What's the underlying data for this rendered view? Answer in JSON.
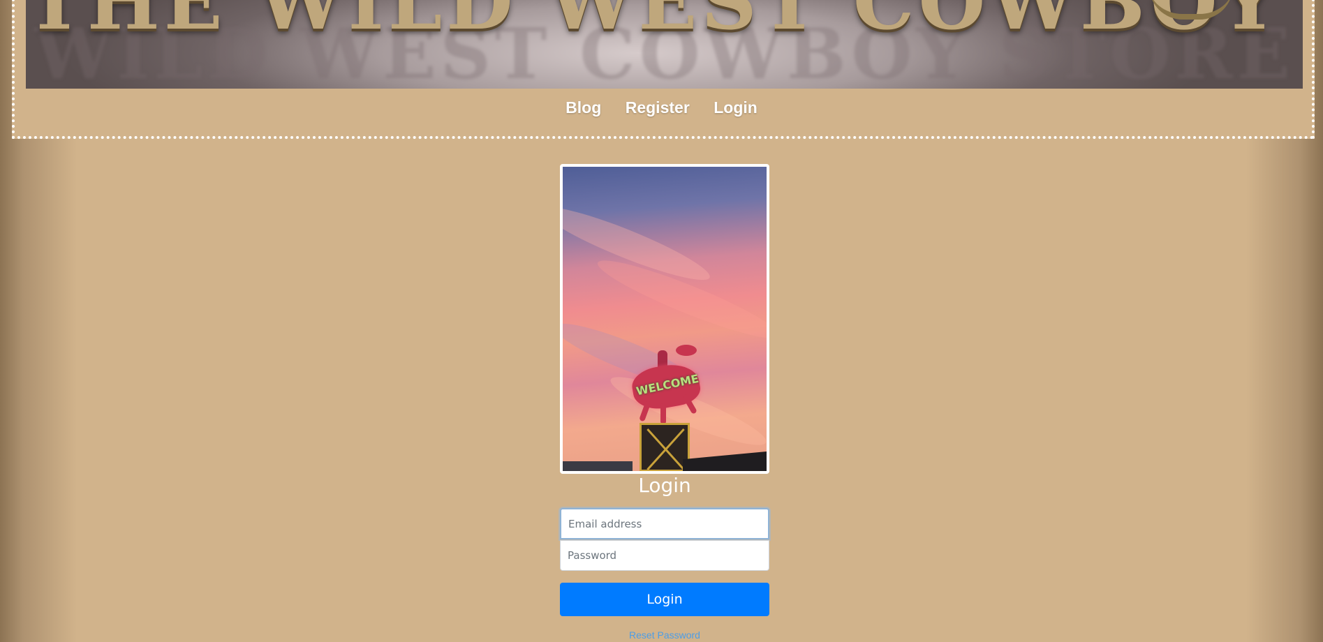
{
  "header": {
    "banner_title": "THE WILD WEST COWBOY STORE",
    "banner_shadow_text": "WILD WEST COWBOY STORE"
  },
  "nav": {
    "items": [
      {
        "label": "Blog"
      },
      {
        "label": "Register"
      },
      {
        "label": "Login"
      }
    ]
  },
  "hero": {
    "sign_text": "WELCOME"
  },
  "login": {
    "title": "Login",
    "email_placeholder": "Email address",
    "password_placeholder": "Password",
    "submit_label": "Login",
    "reset_label": "Reset Password"
  },
  "colors": {
    "background": "#d1b38b",
    "accent": "#007bff",
    "link": "#4d9de6"
  },
  "icons": [
    "welcome-sign-image"
  ]
}
